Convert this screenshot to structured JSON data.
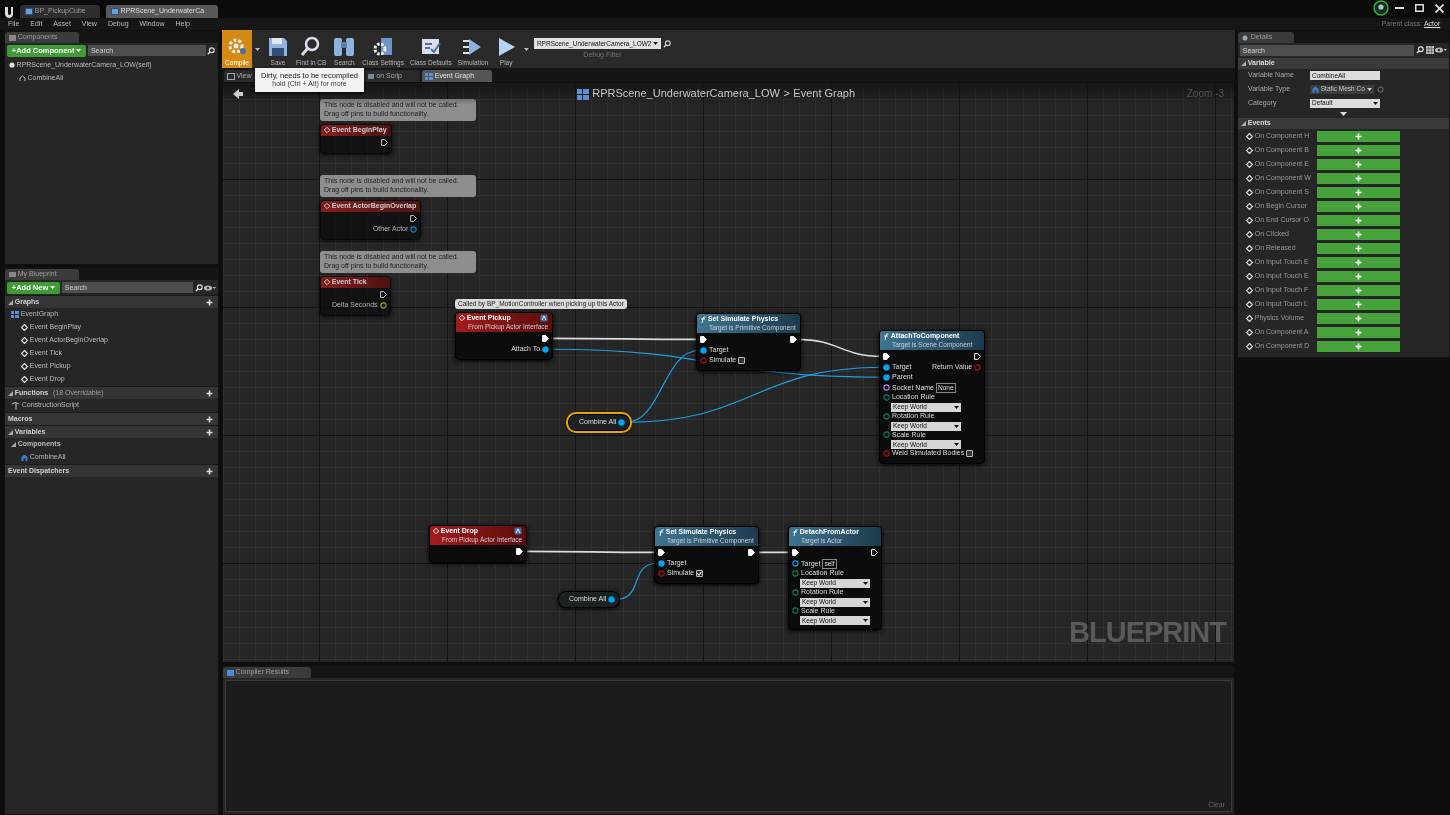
{
  "title_bar": {
    "tabs": [
      {
        "label": "BP_PickupCube",
        "selected": false
      },
      {
        "label": "RPRScene_UnderwaterCa",
        "selected": true
      }
    ]
  },
  "menu": [
    "File",
    "Edit",
    "Asset",
    "View",
    "Debug",
    "Window",
    "Help"
  ],
  "parent_class": {
    "label": "Parent class:",
    "value": "Actor"
  },
  "components_panel": {
    "tab": "Components",
    "add_button": "+Add Component",
    "search": {
      "placeholder": "Search"
    },
    "tree": [
      {
        "label": "RPRScene_UnderwaterCamera_LOW(self)",
        "kind": "root",
        "children": [
          {
            "label": "CombineAll",
            "kind": "mesh"
          }
        ]
      }
    ]
  },
  "my_blueprint": {
    "tab": "My Blueprint",
    "add_button": "+Add New",
    "search": {
      "placeholder": "Search"
    },
    "sections": [
      {
        "label": "Graphs",
        "expanded": true,
        "addable": true,
        "items": [
          {
            "label": "EventGraph",
            "kind": "graph",
            "children": [
              {
                "label": "Event BeginPlay",
                "kind": "event"
              },
              {
                "label": "Event ActorBeginOverlap",
                "kind": "event"
              },
              {
                "label": "Event Tick",
                "kind": "event"
              },
              {
                "label": "Event Pickup",
                "kind": "event"
              },
              {
                "label": "Event Drop",
                "kind": "event"
              }
            ]
          }
        ]
      },
      {
        "label": "Functions",
        "note": "(18 Overridable)",
        "expanded": true,
        "addable": true,
        "items": [
          {
            "label": "ConstructionScript",
            "kind": "function"
          }
        ]
      },
      {
        "label": "Macros",
        "expanded": false,
        "addable": true
      },
      {
        "label": "Variables",
        "expanded": true,
        "addable": true,
        "items": [
          {
            "label": "Components",
            "kind": "category",
            "children": [
              {
                "label": "CombineAll",
                "kind": "component"
              }
            ]
          }
        ]
      },
      {
        "label": "Event Dispatchers",
        "expanded": false,
        "addable": true
      }
    ]
  },
  "toolbar": [
    {
      "kind": "compile",
      "label": "Compile",
      "highlighted": true,
      "has_menu": true
    },
    {
      "kind": "save",
      "label": "Save",
      "highlighted": false,
      "has_menu": false
    },
    {
      "kind": "find",
      "label": "Find in CB",
      "highlighted": false,
      "has_menu": false
    },
    {
      "kind": "search",
      "label": "Search",
      "highlighted": false,
      "has_menu": false
    },
    {
      "kind": "settings",
      "label": "Class Settings",
      "highlighted": false,
      "has_menu": false
    },
    {
      "kind": "defaults",
      "label": "Class Defaults",
      "highlighted": false,
      "has_menu": false
    },
    {
      "kind": "simulation",
      "label": "Simulation",
      "highlighted": false,
      "has_menu": false
    },
    {
      "kind": "play",
      "label": "Play",
      "highlighted": false,
      "has_menu": true
    }
  ],
  "debug_filter": {
    "value": "RPRScene_UnderwaterCamera_LOW2",
    "label": "Debug Filter"
  },
  "tooltip": {
    "title": "Dirty, needs to be recompiled",
    "hint": "hold (Ctrl + Alt) for more"
  },
  "editor_tabs": [
    {
      "label": "View",
      "kind": "viewport",
      "selected": false
    },
    {
      "label": "on Scrip",
      "kind": "script",
      "selected": false
    },
    {
      "label": "Event Graph",
      "kind": "graph",
      "selected": true
    }
  ],
  "graph": {
    "breadcrumb": [
      "RPRScene_UnderwaterCamera_LOW",
      "Event Graph"
    ],
    "separator": ">",
    "zoom": "Zoom -3",
    "watermark": "BLUEPRINT",
    "nodes": [
      {
        "kind": "event",
        "title": "Event BeginPlay",
        "disabled": true,
        "comment": "This node is disabled and will not be called.\nDrag off pins to build functionality.",
        "outputs": [
          {
            "kind": "exec",
            "linked": false
          }
        ]
      },
      {
        "kind": "event",
        "title": "Event ActorBeginOverlap",
        "disabled": true,
        "comment": "This node is disabled and will not be called.\nDrag off pins to build functionality.",
        "outputs": [
          {
            "kind": "exec",
            "linked": false
          },
          {
            "kind": "object",
            "label": "Other Actor",
            "linked": false
          }
        ]
      },
      {
        "kind": "event",
        "title": "Event Tick",
        "disabled": true,
        "comment": "This node is disabled and will not be called.\nDrag off pins to build functionality.",
        "outputs": [
          {
            "kind": "exec",
            "linked": false
          },
          {
            "kind": "float",
            "label": "Delta Seconds",
            "linked": false
          }
        ]
      },
      {
        "kind": "event",
        "title": "Event Pickup",
        "subtitle": "From Pickup Actor Interface",
        "disabled": false,
        "comment": "Called by BP_MotionController when picking up this Actor",
        "outputs": [
          {
            "kind": "exec",
            "linked": true
          },
          {
            "kind": "object",
            "label": "Attach To",
            "linked": true
          }
        ]
      },
      {
        "kind": "function",
        "title": "Set Simulate Physics",
        "subtitle": "Target is Primitive Component",
        "inputs": [
          {
            "kind": "exec",
            "linked": true
          },
          {
            "kind": "object",
            "label": "Target",
            "linked": true
          },
          {
            "kind": "bool",
            "label": "Simulate",
            "linked": false,
            "checked": false
          }
        ],
        "outputs": [
          {
            "kind": "exec",
            "linked": true
          }
        ]
      },
      {
        "kind": "function",
        "title": "AttachToComponent",
        "subtitle": "Target is Scene Component",
        "inputs": [
          {
            "kind": "exec",
            "linked": true
          },
          {
            "kind": "object",
            "label": "Target",
            "linked": true
          },
          {
            "kind": "object",
            "label": "Parent",
            "linked": true
          },
          {
            "kind": "name",
            "label": "Socket Name",
            "linked": false,
            "value": "None"
          },
          {
            "kind": "enum",
            "label": "Location Rule",
            "linked": false,
            "value": "Keep World"
          },
          {
            "kind": "enum",
            "label": "Rotation Rule",
            "linked": false,
            "value": "Keep World"
          },
          {
            "kind": "enum",
            "label": "Scale Rule",
            "linked": false,
            "value": "Keep World"
          },
          {
            "kind": "bool",
            "label": "Weld Simulated Bodies",
            "linked": false,
            "checked": false
          }
        ],
        "outputs": [
          {
            "kind": "exec",
            "linked": false
          },
          {
            "kind": "bool",
            "label": "Return Value",
            "linked": false
          }
        ]
      },
      {
        "kind": "variable",
        "label": "Combine All",
        "selected": true,
        "outputs": [
          {
            "kind": "object",
            "linked": true
          }
        ]
      },
      {
        "kind": "event",
        "title": "Event Drop",
        "subtitle": "From Pickup Actor Interface",
        "disabled": false,
        "outputs": [
          {
            "kind": "exec",
            "linked": true
          }
        ]
      },
      {
        "kind": "function",
        "title": "Set Simulate Physics",
        "subtitle": "Target is Primitive Component",
        "inputs": [
          {
            "kind": "exec",
            "linked": true
          },
          {
            "kind": "object",
            "label": "Target",
            "linked": true
          },
          {
            "kind": "bool",
            "label": "Simulate",
            "linked": false,
            "checked": true
          }
        ],
        "outputs": [
          {
            "kind": "exec",
            "linked": true
          }
        ]
      },
      {
        "kind": "function",
        "title": "DetachFromActor",
        "subtitle": "Target is Actor",
        "inputs": [
          {
            "kind": "exec",
            "linked": true
          },
          {
            "kind": "object",
            "label": "Target",
            "linked": false,
            "value": "self"
          },
          {
            "kind": "enum",
            "label": "Location Rule",
            "linked": false,
            "value": "Keep World"
          },
          {
            "kind": "enum",
            "label": "Rotation Rule",
            "linked": false,
            "value": "Keep World"
          },
          {
            "kind": "enum",
            "label": "Scale Rule",
            "linked": false,
            "value": "Keep World"
          }
        ],
        "outputs": [
          {
            "kind": "exec",
            "linked": false
          }
        ]
      },
      {
        "kind": "variable",
        "label": "Combine All",
        "selected": false,
        "outputs": [
          {
            "kind": "object",
            "linked": true
          }
        ]
      }
    ]
  },
  "compiler_results": {
    "tab": "Compiler Results",
    "clear_button": "Clear"
  },
  "details": {
    "tab": "Details",
    "search": {
      "placeholder": "Search"
    },
    "variable": {
      "label": "Variable",
      "fields": [
        {
          "label": "Variable Name",
          "kind": "text",
          "value": "CombineAll"
        },
        {
          "label": "Variable Type",
          "kind": "type",
          "value": "Static Mesh Co"
        },
        {
          "label": "Category",
          "kind": "select",
          "value": "Default"
        }
      ]
    },
    "events": {
      "label": "Events",
      "items": [
        "On Component H",
        "On Component B",
        "On Component E",
        "On Component W",
        "On Component S",
        "On Begin Cursor",
        "On End Cursor O",
        "On Clicked",
        "On Released",
        "On Input Touch E",
        "On Input Touch E",
        "On Input Touch F",
        "On Input Touch L",
        "Physics Volume",
        "On Component A",
        "On Component D"
      ]
    }
  }
}
